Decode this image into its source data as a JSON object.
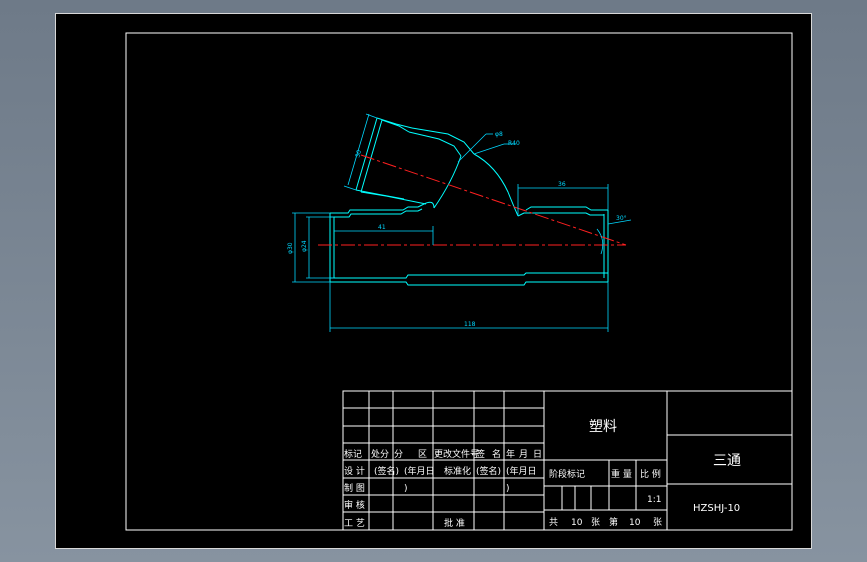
{
  "drawing": {
    "dimensions": {
      "d1": "30",
      "d2": "R40",
      "d3": "φ8",
      "d4": "36",
      "angle": "30°",
      "outer_diameter": "φ30",
      "inner_diameter": "φ24",
      "length_left": "41",
      "total_length": "118"
    }
  },
  "title_block": {
    "material": "塑料",
    "part_name": "三通",
    "drawing_number": "HZSHJ-10",
    "revision_headers": [
      "标记",
      "处分",
      "分",
      "区",
      "更改文件号",
      "签",
      "名",
      "年",
      "月",
      "日"
    ],
    "rows": {
      "design": {
        "label": "设 计",
        "sign": "(签名)",
        "date": "(年月日",
        "std": "标准化",
        "sign2": "(签名)",
        "date2": "(年月日"
      },
      "drafting": {
        "label": "制 图",
        "paren1": ")",
        "paren2": ")"
      },
      "review": {
        "label": "审 核"
      },
      "process": {
        "label": "工 艺",
        "approve": "批 准"
      }
    },
    "stage_mark": "阶段标记",
    "weight": "重 量",
    "scale_label": "比 例",
    "scale": "1:1",
    "sheets": {
      "total_label": "共",
      "total": "10",
      "sheet_unit": "张",
      "current_label": "第",
      "current": "10",
      "current_unit": "张"
    }
  },
  "colors": {
    "outline": "#00ffff",
    "centerline": "#ff2020",
    "dimension": "#00d8ff",
    "frame": "#ffffff"
  }
}
